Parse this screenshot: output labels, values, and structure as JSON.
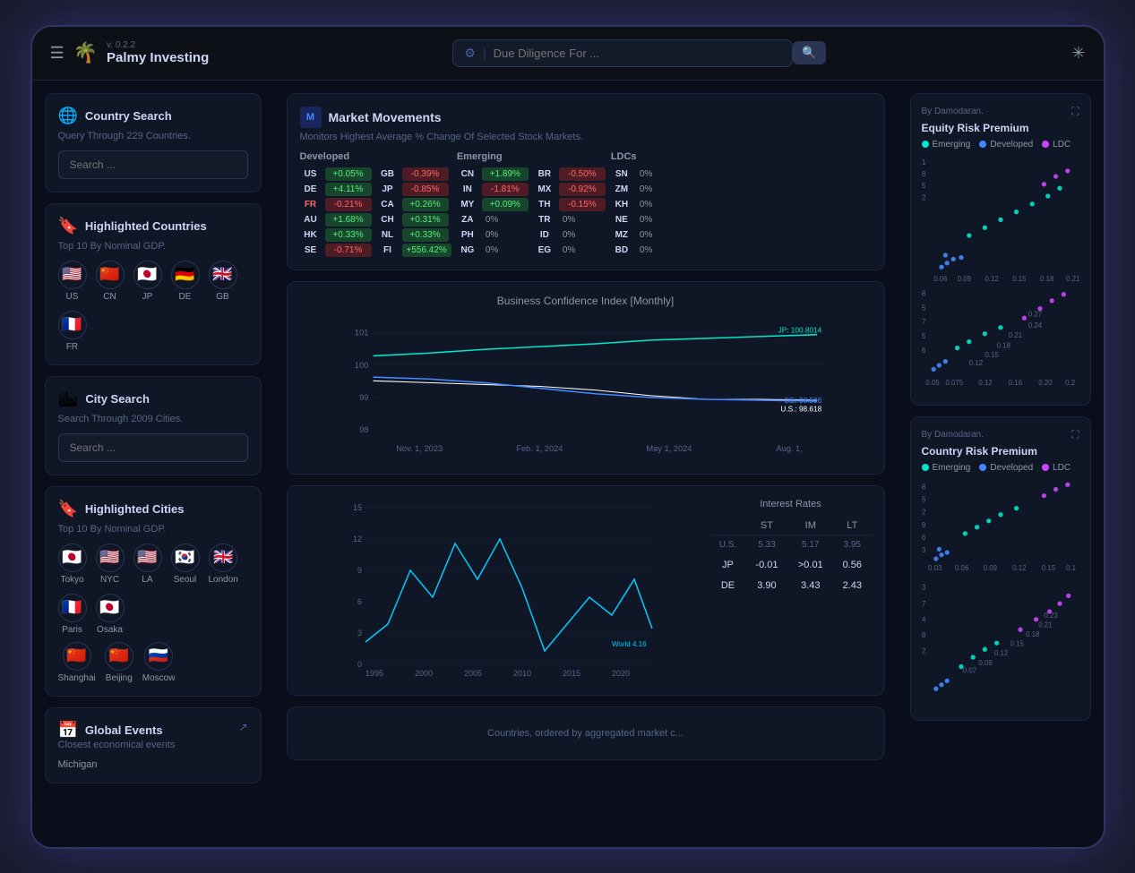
{
  "app": {
    "version": "v. 0.2.2",
    "name": "Palmy Investing",
    "search_placeholder": "Due Diligence For ..."
  },
  "sidebar": {
    "country_search": {
      "title": "Country Search",
      "subtitle": "Query Through 229 Countries.",
      "search_placeholder": "Search ..."
    },
    "highlighted_countries": {
      "title": "Highlighted Countries",
      "subtitle": "Top 10 By Nominal GDP.",
      "flags": [
        {
          "code": "US",
          "emoji": "🇺🇸"
        },
        {
          "code": "CN",
          "emoji": "🇨🇳"
        },
        {
          "code": "JP",
          "emoji": "🇯🇵"
        },
        {
          "code": "DE",
          "emoji": "🇩🇪"
        },
        {
          "code": "GB",
          "emoji": "🇬🇧"
        },
        {
          "code": "FR",
          "emoji": "🇫🇷"
        }
      ]
    },
    "city_search": {
      "title": "City Search",
      "subtitle": "Search Through 2009 Cities.",
      "search_placeholder": "Search ..."
    },
    "highlighted_cities": {
      "title": "Highlighted Cities",
      "subtitle": "Top 10 By Nominal GDP.",
      "flags_row1": [
        {
          "code": "Tokyo",
          "emoji": "🇯🇵"
        },
        {
          "code": "NYC",
          "emoji": "🇺🇸"
        },
        {
          "code": "LA",
          "emoji": "🇺🇸"
        },
        {
          "code": "Seoul",
          "emoji": "🇰🇷"
        },
        {
          "code": "London",
          "emoji": "🇬🇧"
        },
        {
          "code": "Paris",
          "emoji": "🇫🇷"
        },
        {
          "code": "Osaka",
          "emoji": "🇯🇵"
        }
      ],
      "flags_row2": [
        {
          "code": "Shanghai",
          "emoji": "🇨🇳"
        },
        {
          "code": "Beijing",
          "emoji": "🇨🇳"
        },
        {
          "code": "Moscow",
          "emoji": "🇷🇺"
        }
      ]
    },
    "global_events": {
      "title": "Global Events",
      "subtitle": "Closest economical events",
      "first_item": "Michigan"
    }
  },
  "market_movements": {
    "title": "Market Movements",
    "subtitle": "Monitors Highest Average % Change Of Selected Stock Markets.",
    "developed": {
      "header": "Developed",
      "rows": [
        {
          "tag": "US",
          "change": "+0.05%",
          "pos": true
        },
        {
          "tag": "DE",
          "change": "+4.11%",
          "pos": true
        },
        {
          "tag": "FR",
          "change": "-0.21%",
          "pos": false
        },
        {
          "tag": "AU",
          "change": "+1.68%",
          "pos": true
        },
        {
          "tag": "HK",
          "change": "+0.33%",
          "pos": true
        },
        {
          "tag": "SE",
          "change": "-0.71%",
          "pos": false
        }
      ]
    },
    "developed2": {
      "rows": [
        {
          "tag": "GB",
          "change": "-0.39%",
          "pos": false
        },
        {
          "tag": "JP",
          "change": "-0.85%",
          "pos": false
        },
        {
          "tag": "CA",
          "change": "+0.26%",
          "pos": true
        },
        {
          "tag": "CH",
          "change": "+0.31%",
          "pos": true
        },
        {
          "tag": "NL",
          "change": "+0.33%",
          "pos": true
        },
        {
          "tag": "FI",
          "change": "+556.42%",
          "pos": true
        }
      ]
    },
    "emerging": {
      "header": "Emerging",
      "rows": [
        {
          "tag": "CN",
          "change": "+1.89%",
          "pos": true
        },
        {
          "tag": "IN",
          "change": "-1.81%",
          "pos": false
        },
        {
          "tag": "MY",
          "change": "+0.09%",
          "pos": true
        },
        {
          "tag": "ZA",
          "change": "0%",
          "pos": null
        },
        {
          "tag": "PH",
          "change": "0%",
          "pos": null
        },
        {
          "tag": "NG",
          "change": "0%",
          "pos": null
        }
      ]
    },
    "emerging2": {
      "rows": [
        {
          "tag": "BR",
          "change": "-0.50%",
          "pos": false
        },
        {
          "tag": "MX",
          "change": "-0.92%",
          "pos": false
        },
        {
          "tag": "TH",
          "change": "-0.15%",
          "pos": false
        },
        {
          "tag": "TR",
          "change": "0%",
          "pos": null
        },
        {
          "tag": "ID",
          "change": "0%",
          "pos": null
        },
        {
          "tag": "EG",
          "change": "0%",
          "pos": null
        }
      ]
    },
    "ldcs": {
      "header": "LDCs",
      "rows": [
        {
          "tag": "SN",
          "change": "0%"
        },
        {
          "tag": "ZM",
          "change": "0%"
        },
        {
          "tag": "KH",
          "change": "0%"
        },
        {
          "tag": "NE",
          "change": "0%"
        },
        {
          "tag": "MZ",
          "change": "0%"
        },
        {
          "tag": "BD",
          "change": "0%"
        }
      ]
    }
  },
  "bci": {
    "title": "Business Confidence Index [Monthly]",
    "label_jp": "JP: 100.8014",
    "label_de": "DE: 98.506",
    "label_us": "U.S.: 98.618",
    "x_labels": [
      "Nov. 1, 2023",
      "Feb. 1, 2024",
      "May 1, 2024",
      "Aug. 1,"
    ],
    "y_labels": [
      "101",
      "100",
      "99",
      "98"
    ]
  },
  "interest_rates": {
    "title": "Interest Rates",
    "headers": [
      "",
      "ST",
      "IM",
      "LT"
    ],
    "rows": [
      {
        "country": "U.S.",
        "st": "5.33",
        "im": "5.17",
        "lt": "3.95"
      },
      {
        "country": "JP",
        "st": "-0.01",
        "im": ">0.01",
        "lt": "0.56"
      },
      {
        "country": "DE",
        "st": "3.90",
        "im": "3.43",
        "lt": "2.43"
      }
    ],
    "world_label": "World 4.16"
  },
  "equity_risk": {
    "by": "By Damodaran.",
    "title": "Equity Risk Premium",
    "legend": [
      {
        "label": "Emerging",
        "color": "#00e5cc"
      },
      {
        "label": "Developed",
        "color": "#4488ff"
      },
      {
        "label": "LDC",
        "color": "#cc44ff"
      }
    ]
  },
  "country_risk": {
    "by": "By Damodaran.",
    "title": "Country Risk Premium",
    "legend": [
      {
        "label": "Emerging",
        "color": "#00e5cc"
      },
      {
        "label": "Developed",
        "color": "#4488ff"
      },
      {
        "label": "LDC",
        "color": "#cc44ff"
      }
    ]
  },
  "bottom_stub": {
    "text": "Countries, ordered by aggregated market c..."
  }
}
